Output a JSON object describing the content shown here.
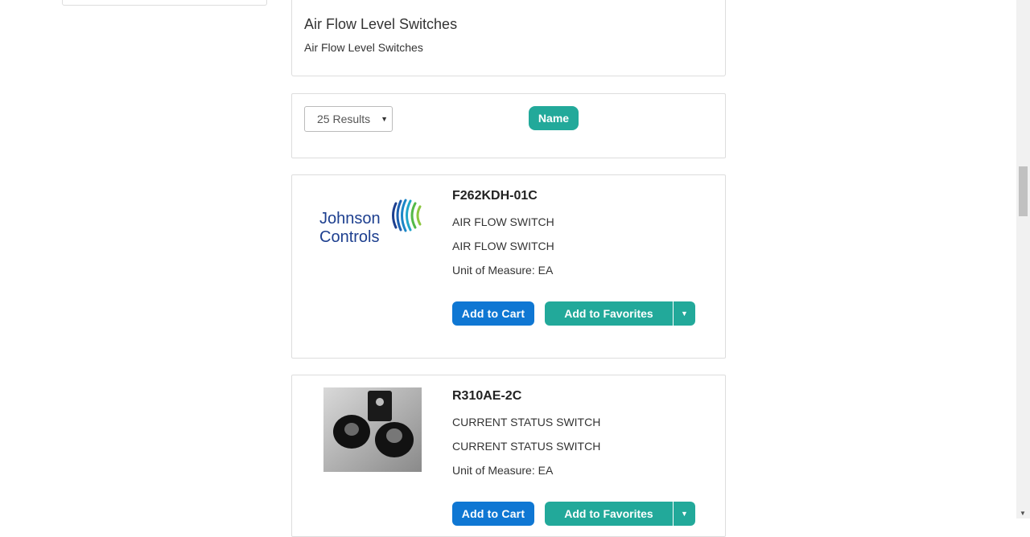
{
  "category": {
    "title": "Air Flow Level Switches",
    "description": "Air Flow Level Switches"
  },
  "sort_bar": {
    "results_per_page": "25 Results",
    "sort_name_label": "Name"
  },
  "products": [
    {
      "image": "johnson-controls-logo",
      "brand_line1": "Johnson",
      "brand_line2": "Controls",
      "part_number": "F262KDH-01C",
      "description1": "AIR FLOW SWITCH",
      "description2": "AIR FLOW SWITCH",
      "uom_label": "Unit of Measure: ",
      "uom_value": "EA",
      "add_to_cart": "Add to Cart",
      "add_to_favorites": "Add to Favorites"
    },
    {
      "image": "current-switch-photo",
      "part_number": "R310AE-2C",
      "description1": "CURRENT STATUS SWITCH",
      "description2": "CURRENT STATUS SWITCH",
      "uom_label": "Unit of Measure: ",
      "uom_value": "EA",
      "add_to_cart": "Add to Cart",
      "add_to_favorites": "Add to Favorites"
    }
  ],
  "colors": {
    "teal": "#22a99a",
    "blue": "#0f77d3",
    "brand_navy": "#1d3f8f"
  }
}
